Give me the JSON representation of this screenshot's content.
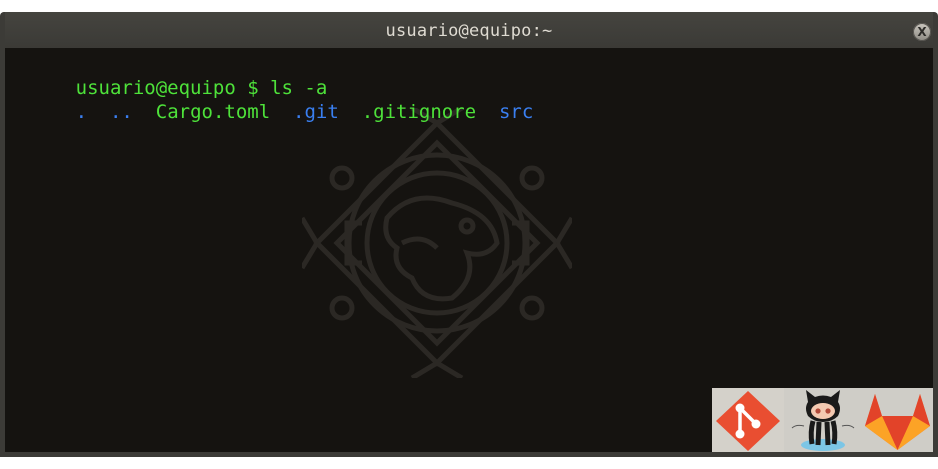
{
  "window": {
    "title": "usuario@equipo:~",
    "close_label": "X"
  },
  "terminal": {
    "prompt": "usuario@equipo $ ",
    "command": "ls -a",
    "output": [
      {
        "text": ".",
        "color": "blue"
      },
      {
        "text": "..",
        "color": "blue"
      },
      {
        "text": "Cargo.toml",
        "color": "green"
      },
      {
        "text": ".git",
        "color": "blue"
      },
      {
        "text": ".gitignore",
        "color": "green"
      },
      {
        "text": "src",
        "color": "blue"
      }
    ]
  },
  "colors": {
    "background": "#151310",
    "titlebar": "#3c3b37",
    "green": "#4ee23a",
    "blue": "#3a7ff0"
  },
  "logos": [
    "git-icon",
    "github-octocat-icon",
    "gitlab-icon"
  ],
  "watermark": "aztec-sun-emblem"
}
